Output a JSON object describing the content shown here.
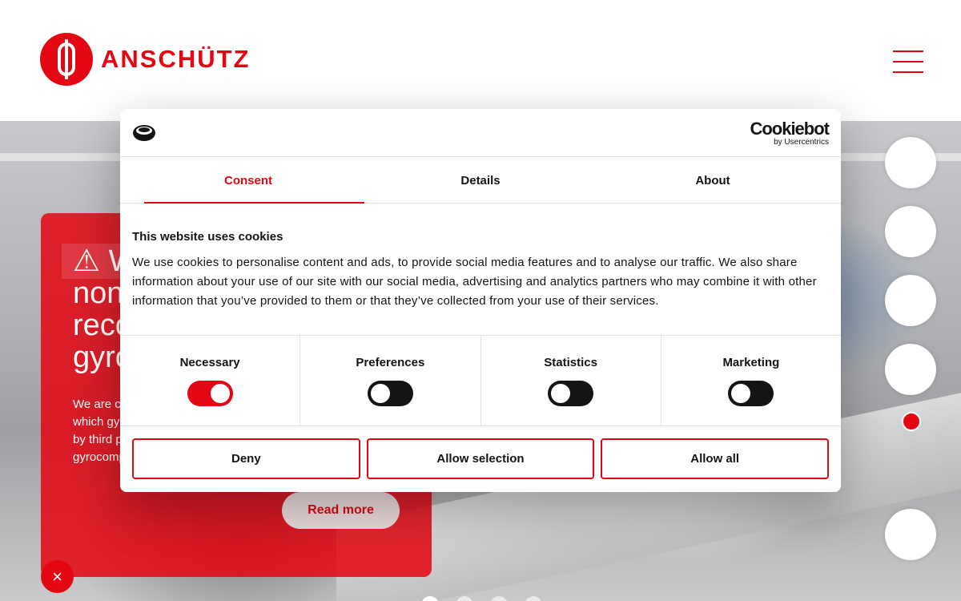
{
  "brand": {
    "name": "ANSCHÜTZ",
    "color": "#e30613"
  },
  "header": {
    "menu_icon": "hamburger-menu-icon"
  },
  "hero": {
    "title": "⚠ W… non… reco… gyro…",
    "title_lines": [
      "⚠ W",
      "non",
      "reco",
      "gyro"
    ],
    "body_lines": [
      "We are c",
      "which gy",
      "by third p",
      "gyrocomp"
    ],
    "read_more": "Read more",
    "close_icon": "×"
  },
  "cookie_dialog": {
    "logo_icon": "cookie-icon",
    "brand_name": "Cookiebot",
    "brand_by": "by Usercentrics",
    "tabs": [
      {
        "label": "Consent",
        "active": true
      },
      {
        "label": "Details",
        "active": false
      },
      {
        "label": "About",
        "active": false
      }
    ],
    "heading": "This website uses cookies",
    "text": "We use cookies to personalise content and ads, to provide social media features and to analyse our traffic. We also share information about your use of our site with our social media, advertising and analytics partners who may combine it with other information that you’ve provided to them or that they’ve collected from your use of their services.",
    "categories": [
      {
        "label": "Necessary",
        "enabled": true
      },
      {
        "label": "Preferences",
        "enabled": false
      },
      {
        "label": "Statistics",
        "enabled": false
      },
      {
        "label": "Marketing",
        "enabled": false
      }
    ],
    "buttons": {
      "deny": "Deny",
      "allow_selection": "Allow selection",
      "allow_all": "Allow all"
    }
  }
}
